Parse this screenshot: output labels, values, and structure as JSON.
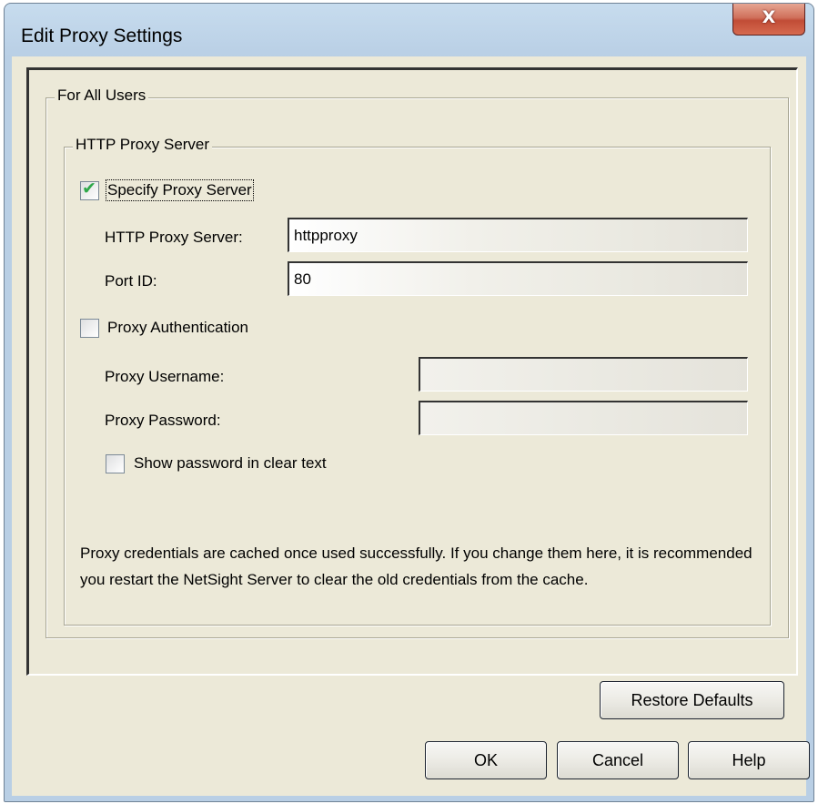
{
  "window": {
    "title": "Edit Proxy Settings",
    "close_glyph": "X"
  },
  "groups": {
    "all_users_title": "For All Users",
    "http_proxy_title": "HTTP Proxy Server"
  },
  "proxy": {
    "specify_label": "Specify Proxy Server",
    "specify_checked": true,
    "server_label": "HTTP Proxy Server:",
    "server_value": "httpproxy",
    "port_label": "Port ID:",
    "port_value": "80"
  },
  "auth": {
    "label": "Proxy Authentication",
    "checked": false,
    "username_label": "Proxy Username:",
    "username_value": "",
    "password_label": "Proxy Password:",
    "password_value": "",
    "show_password_label": "Show password in clear text",
    "show_password_checked": false
  },
  "note": "Proxy credentials are cached once used successfully. If you change them here, it is recommended you restart the NetSight Server to clear the old credentials from the cache.",
  "buttons": {
    "restore_defaults": "Restore Defaults",
    "ok": "OK",
    "cancel": "Cancel",
    "help": "Help"
  },
  "icons": {
    "check": "check-icon",
    "close": "close-icon"
  },
  "colors": {
    "dialog_background": "#ece9d8",
    "title_bar": "#b9cfe5",
    "close_button": "#c14c36",
    "check_mark": "#2fa84a"
  }
}
